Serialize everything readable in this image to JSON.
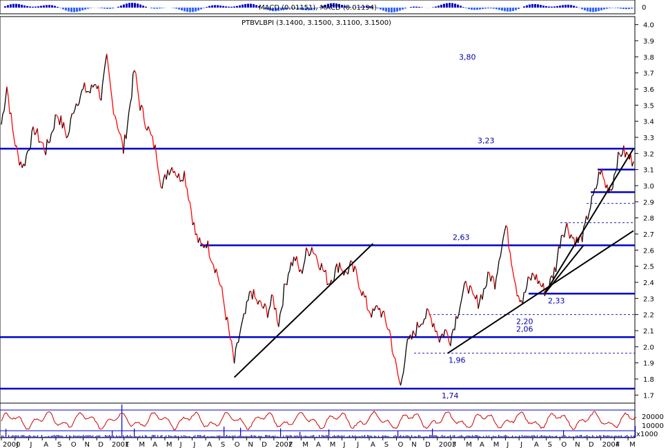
{
  "chart_data": {
    "type": "line",
    "title": "PTBVLBPI (3.1400, 3.1500, 3.1100, 3.1500)",
    "macd_label": "MACD (0.01151), MACD (0.01194)",
    "macd_axis_label": "0",
    "volume_axis_labels": [
      "20000",
      "10000",
      "x1000"
    ],
    "y_ticks": [
      "4.0",
      "3.9",
      "3.8",
      "3.7",
      "3.6",
      "3.5",
      "3.4",
      "3.3",
      "3.2",
      "3.1",
      "3.0",
      "2.9",
      "2.8",
      "2.7",
      "2.6",
      "2.5",
      "2.4",
      "2.3",
      "2.2",
      "2.1",
      "2.0",
      "1.9",
      "1.8",
      "1.7"
    ],
    "ylim": [
      1.65,
      4.05
    ],
    "x_labels": [
      "2000",
      "J",
      "J",
      "A",
      "S",
      "O",
      "N",
      "D",
      "2001",
      "F",
      "M",
      "A",
      "M",
      "J",
      "J",
      "A",
      "S",
      "O",
      "N",
      "D",
      "2002",
      "F",
      "M",
      "A",
      "M",
      "J",
      "J",
      "A",
      "S",
      "O",
      "N",
      "D",
      "2003",
      "F",
      "M",
      "A",
      "M",
      "J",
      "J",
      "A",
      "S",
      "O",
      "N",
      "D",
      "2004",
      "F",
      "M"
    ],
    "price_path": [
      {
        "i": 0,
        "y": 3.38
      },
      {
        "i": 4,
        "y": 3.62
      },
      {
        "i": 8,
        "y": 3.35
      },
      {
        "i": 12,
        "y": 3.18
      },
      {
        "i": 16,
        "y": 3.12
      },
      {
        "i": 20,
        "y": 3.25
      },
      {
        "i": 24,
        "y": 3.35
      },
      {
        "i": 28,
        "y": 3.28
      },
      {
        "i": 32,
        "y": 3.22
      },
      {
        "i": 36,
        "y": 3.32
      },
      {
        "i": 40,
        "y": 3.45
      },
      {
        "i": 44,
        "y": 3.38
      },
      {
        "i": 48,
        "y": 3.3
      },
      {
        "i": 52,
        "y": 3.48
      },
      {
        "i": 56,
        "y": 3.55
      },
      {
        "i": 60,
        "y": 3.6
      },
      {
        "i": 64,
        "y": 3.58
      },
      {
        "i": 68,
        "y": 3.65
      },
      {
        "i": 72,
        "y": 3.55
      },
      {
        "i": 76,
        "y": 3.78
      },
      {
        "i": 80,
        "y": 3.52
      },
      {
        "i": 84,
        "y": 3.38
      },
      {
        "i": 88,
        "y": 3.22
      },
      {
        "i": 92,
        "y": 3.45
      },
      {
        "i": 96,
        "y": 3.72
      },
      {
        "i": 100,
        "y": 3.5
      },
      {
        "i": 104,
        "y": 3.4
      },
      {
        "i": 108,
        "y": 3.3
      },
      {
        "i": 112,
        "y": 3.2
      },
      {
        "i": 116,
        "y": 2.98
      },
      {
        "i": 120,
        "y": 3.1
      },
      {
        "i": 124,
        "y": 3.12
      },
      {
        "i": 128,
        "y": 3.05
      },
      {
        "i": 132,
        "y": 3.08
      },
      {
        "i": 136,
        "y": 2.9
      },
      {
        "i": 140,
        "y": 2.7
      },
      {
        "i": 144,
        "y": 2.62
      },
      {
        "i": 148,
        "y": 2.65
      },
      {
        "i": 152,
        "y": 2.55
      },
      {
        "i": 156,
        "y": 2.45
      },
      {
        "i": 160,
        "y": 2.3
      },
      {
        "i": 164,
        "y": 2.1
      },
      {
        "i": 168,
        "y": 1.9
      },
      {
        "i": 172,
        "y": 2.08
      },
      {
        "i": 176,
        "y": 2.2
      },
      {
        "i": 180,
        "y": 2.35
      },
      {
        "i": 184,
        "y": 2.28
      },
      {
        "i": 188,
        "y": 2.25
      },
      {
        "i": 192,
        "y": 2.22
      },
      {
        "i": 196,
        "y": 2.3
      },
      {
        "i": 200,
        "y": 2.15
      },
      {
        "i": 204,
        "y": 2.35
      },
      {
        "i": 208,
        "y": 2.5
      },
      {
        "i": 212,
        "y": 2.55
      },
      {
        "i": 216,
        "y": 2.45
      },
      {
        "i": 220,
        "y": 2.58
      },
      {
        "i": 224,
        "y": 2.62
      },
      {
        "i": 228,
        "y": 2.55
      },
      {
        "i": 232,
        "y": 2.48
      },
      {
        "i": 236,
        "y": 2.4
      },
      {
        "i": 240,
        "y": 2.45
      },
      {
        "i": 244,
        "y": 2.52
      },
      {
        "i": 248,
        "y": 2.45
      },
      {
        "i": 252,
        "y": 2.5
      },
      {
        "i": 256,
        "y": 2.45
      },
      {
        "i": 260,
        "y": 2.35
      },
      {
        "i": 264,
        "y": 2.25
      },
      {
        "i": 268,
        "y": 2.2
      },
      {
        "i": 272,
        "y": 2.25
      },
      {
        "i": 276,
        "y": 2.18
      },
      {
        "i": 280,
        "y": 2.1
      },
      {
        "i": 284,
        "y": 1.9
      },
      {
        "i": 288,
        "y": 1.75
      },
      {
        "i": 292,
        "y": 2.0
      },
      {
        "i": 296,
        "y": 2.05
      },
      {
        "i": 300,
        "y": 2.12
      },
      {
        "i": 304,
        "y": 2.18
      },
      {
        "i": 308,
        "y": 2.2
      },
      {
        "i": 312,
        "y": 2.15
      },
      {
        "i": 316,
        "y": 2.05
      },
      {
        "i": 320,
        "y": 2.1
      },
      {
        "i": 324,
        "y": 2.05
      },
      {
        "i": 328,
        "y": 2.18
      },
      {
        "i": 332,
        "y": 2.3
      },
      {
        "i": 336,
        "y": 2.4
      },
      {
        "i": 340,
        "y": 2.3
      },
      {
        "i": 344,
        "y": 2.28
      },
      {
        "i": 348,
        "y": 2.35
      },
      {
        "i": 352,
        "y": 2.45
      },
      {
        "i": 356,
        "y": 2.4
      },
      {
        "i": 360,
        "y": 2.6
      },
      {
        "i": 364,
        "y": 2.75
      },
      {
        "i": 368,
        "y": 2.55
      },
      {
        "i": 372,
        "y": 2.35
      },
      {
        "i": 376,
        "y": 2.28
      },
      {
        "i": 380,
        "y": 2.4
      },
      {
        "i": 384,
        "y": 2.45
      },
      {
        "i": 388,
        "y": 2.4
      },
      {
        "i": 392,
        "y": 2.35
      },
      {
        "i": 396,
        "y": 2.4
      },
      {
        "i": 400,
        "y": 2.5
      },
      {
        "i": 404,
        "y": 2.7
      },
      {
        "i": 408,
        "y": 2.75
      },
      {
        "i": 412,
        "y": 2.68
      },
      {
        "i": 416,
        "y": 2.65
      },
      {
        "i": 420,
        "y": 2.7
      },
      {
        "i": 424,
        "y": 2.85
      },
      {
        "i": 428,
        "y": 2.95
      },
      {
        "i": 432,
        "y": 3.1
      },
      {
        "i": 436,
        "y": 3.0
      },
      {
        "i": 440,
        "y": 2.98
      },
      {
        "i": 444,
        "y": 3.15
      },
      {
        "i": 448,
        "y": 3.22
      },
      {
        "i": 452,
        "y": 3.18
      },
      {
        "i": 456,
        "y": 3.15
      }
    ],
    "price_n": 456,
    "horizontal_levels": [
      {
        "value": 3.23,
        "label": "3,23",
        "style": "solid"
      },
      {
        "value": 2.63,
        "label": "2,63",
        "style": "solid"
      },
      {
        "value": 2.33,
        "label": "2,33",
        "style": "solid"
      },
      {
        "value": 2.06,
        "label": "2,06",
        "style": "solid"
      },
      {
        "value": 1.74,
        "label": "1,74",
        "style": "solid"
      },
      {
        "value": 3.1,
        "label": "",
        "style": "solid"
      },
      {
        "value": 2.96,
        "label": "",
        "style": "solid"
      },
      {
        "value": 2.89,
        "label": "",
        "style": "dashed"
      },
      {
        "value": 2.77,
        "label": "",
        "style": "dashed"
      },
      {
        "value": 2.2,
        "label": "2,20",
        "style": "dashed"
      },
      {
        "value": 1.96,
        "label": "1,96",
        "style": "dashed"
      }
    ],
    "annotations": [
      {
        "label": "3,80",
        "value": 3.8
      }
    ],
    "trend_lines": [
      {
        "from": [
          168,
          1.81
        ],
        "to": [
          268,
          2.64
        ]
      },
      {
        "from": [
          322,
          1.96
        ],
        "to": [
          456,
          2.72
        ]
      },
      {
        "from": [
          392,
          2.33
        ],
        "to": [
          456,
          3.23
        ]
      },
      {
        "from": [
          392,
          2.33
        ],
        "to": [
          420,
          2.63
        ]
      }
    ],
    "colors": {
      "up": "#000000",
      "down": "#ff0000",
      "levels": "#0000cc",
      "labels": "#0000aa",
      "oscillator": "#cc0000",
      "volume": "#0000cc"
    }
  }
}
